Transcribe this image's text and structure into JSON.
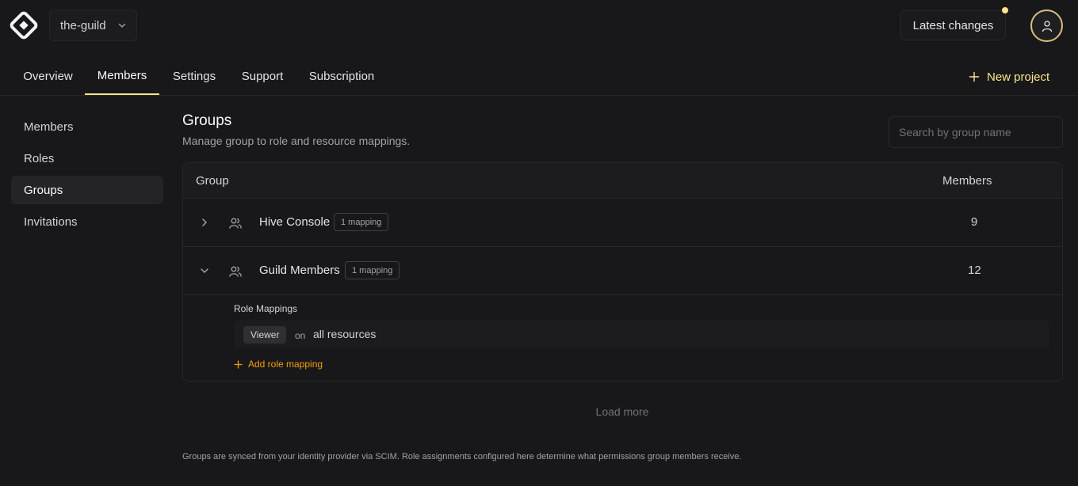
{
  "header": {
    "org_name": "the-guild",
    "latest_changes": "Latest changes",
    "has_notification": true
  },
  "tabs": [
    {
      "label": "Overview",
      "active": false
    },
    {
      "label": "Members",
      "active": true
    },
    {
      "label": "Settings",
      "active": false
    },
    {
      "label": "Support",
      "active": false
    },
    {
      "label": "Subscription",
      "active": false
    }
  ],
  "new_project": "New project",
  "sidebar": {
    "items": [
      {
        "label": "Members",
        "active": false
      },
      {
        "label": "Roles",
        "active": false
      },
      {
        "label": "Groups",
        "active": true
      },
      {
        "label": "Invitations",
        "active": false
      }
    ]
  },
  "page": {
    "title": "Groups",
    "subtitle": "Manage group to role and resource mappings.",
    "search_placeholder": "Search by group name"
  },
  "table": {
    "col_group": "Group",
    "col_members": "Members",
    "rows": [
      {
        "name": "Hive Console",
        "badge": "1 mapping",
        "members": "9",
        "expanded": false
      },
      {
        "name": "Guild Members",
        "badge": "1 mapping",
        "members": "12",
        "expanded": true
      }
    ],
    "expanded": {
      "title": "Role Mappings",
      "role": "Viewer",
      "on": "on",
      "resource": "all resources",
      "add_label": "Add role mapping"
    }
  },
  "load_more": "Load more",
  "footnote": "Groups are synced from your identity provider via SCIM. Role assignments configured here determine what permissions group members receive.",
  "colors": {
    "background": "#18181b",
    "accent": "#fde68a",
    "add_link": "#f59e0b",
    "border": "#27272a"
  }
}
